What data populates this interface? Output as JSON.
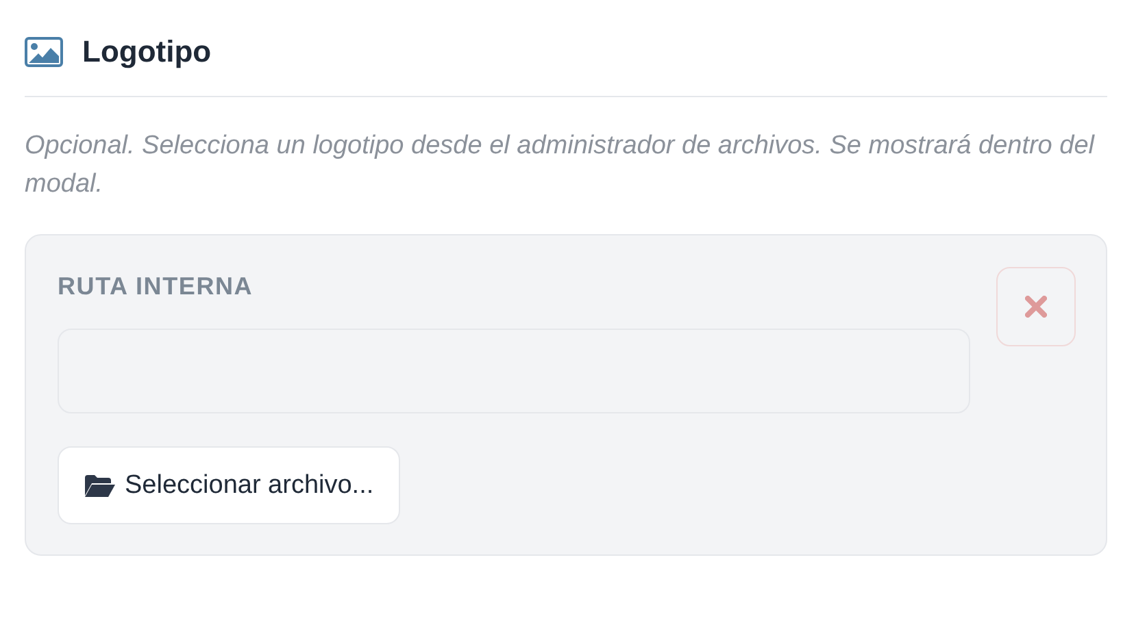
{
  "section": {
    "title": "Logotipo",
    "hint": "Opcional. Selecciona un logotipo desde el administrador de archivos. Se mostrará dentro del modal."
  },
  "path_panel": {
    "label": "RUTA INTERNA",
    "select_button": "Seleccionar archivo..."
  }
}
